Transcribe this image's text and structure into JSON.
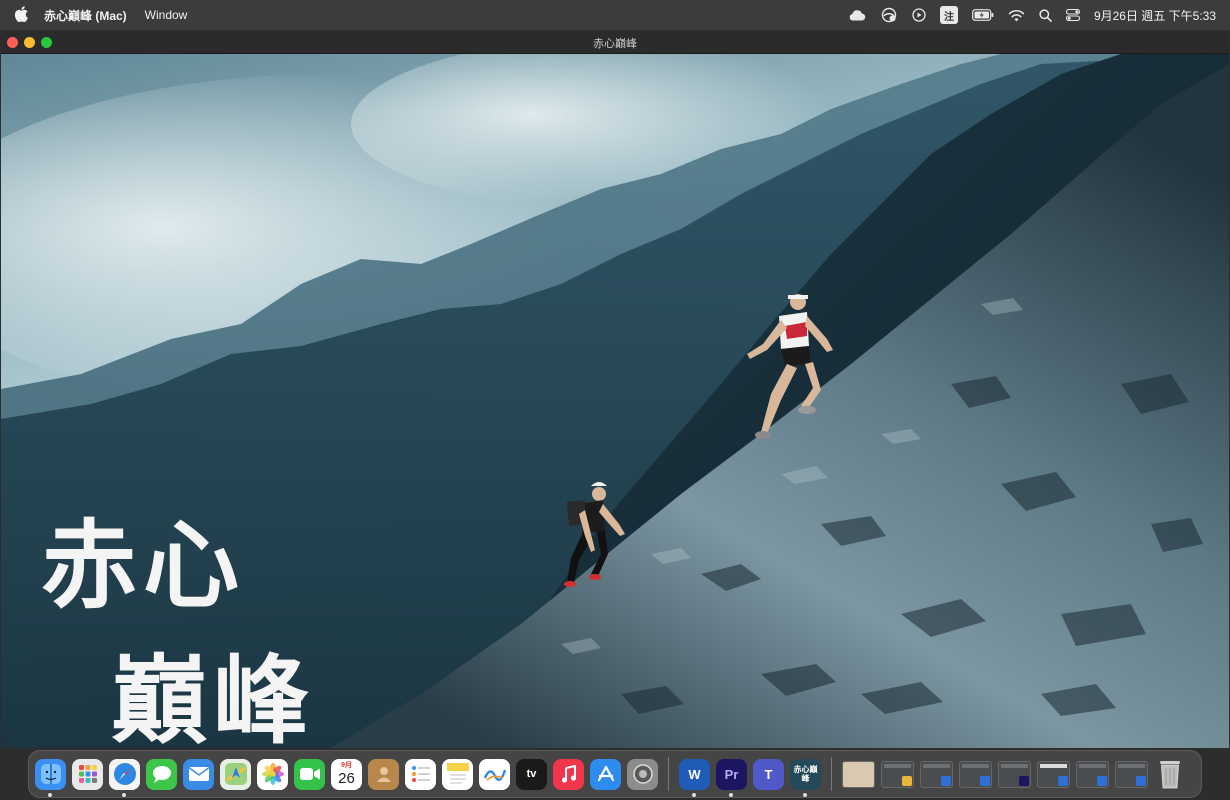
{
  "menubar": {
    "app_name": "赤心巔峰 (Mac)",
    "items": [
      "Window"
    ],
    "input_method": "注",
    "datetime": "9月26日 週五  下午5:33"
  },
  "window": {
    "title": "赤心巔峰"
  },
  "poster": {
    "title_line1": "赤心",
    "title_line2": "巔峰"
  },
  "dock": {
    "apps": [
      {
        "name": "Finder",
        "color": "#3b8ff0",
        "running": true
      },
      {
        "name": "Launchpad",
        "color": "#d9613a",
        "running": false
      },
      {
        "name": "Safari",
        "color": "#2e87e0",
        "running": true
      },
      {
        "name": "Messages",
        "color": "#3cc74b",
        "running": false
      },
      {
        "name": "Mail",
        "color": "#3a8be6",
        "running": false
      },
      {
        "name": "Maps",
        "color": "#5cb85c",
        "running": false
      },
      {
        "name": "Photos",
        "color": "#f0a030",
        "running": false
      },
      {
        "name": "FaceTime",
        "color": "#35c24a",
        "running": false
      },
      {
        "name": "Calendar",
        "color": "#ffffff",
        "running": false
      },
      {
        "name": "Contacts",
        "color": "#b8874a",
        "running": false
      },
      {
        "name": "Reminders",
        "color": "#ffffff",
        "running": false
      },
      {
        "name": "Notes",
        "color": "#f5d14a",
        "running": false
      },
      {
        "name": "Freeform",
        "color": "#ffffff",
        "running": false
      },
      {
        "name": "TV",
        "color": "#1a1a1a",
        "running": false
      },
      {
        "name": "Music",
        "color": "#f0354c",
        "running": false
      },
      {
        "name": "App Store",
        "color": "#2e8cf0",
        "running": false
      },
      {
        "name": "System Settings",
        "color": "#8c8c8c",
        "running": false
      }
    ],
    "calendar": {
      "month": "9月",
      "day": "26"
    },
    "tv_label": "tv",
    "pr_label": "Pr",
    "word_label": "W",
    "teams_label": "T",
    "film_label": "赤心巔峰"
  }
}
